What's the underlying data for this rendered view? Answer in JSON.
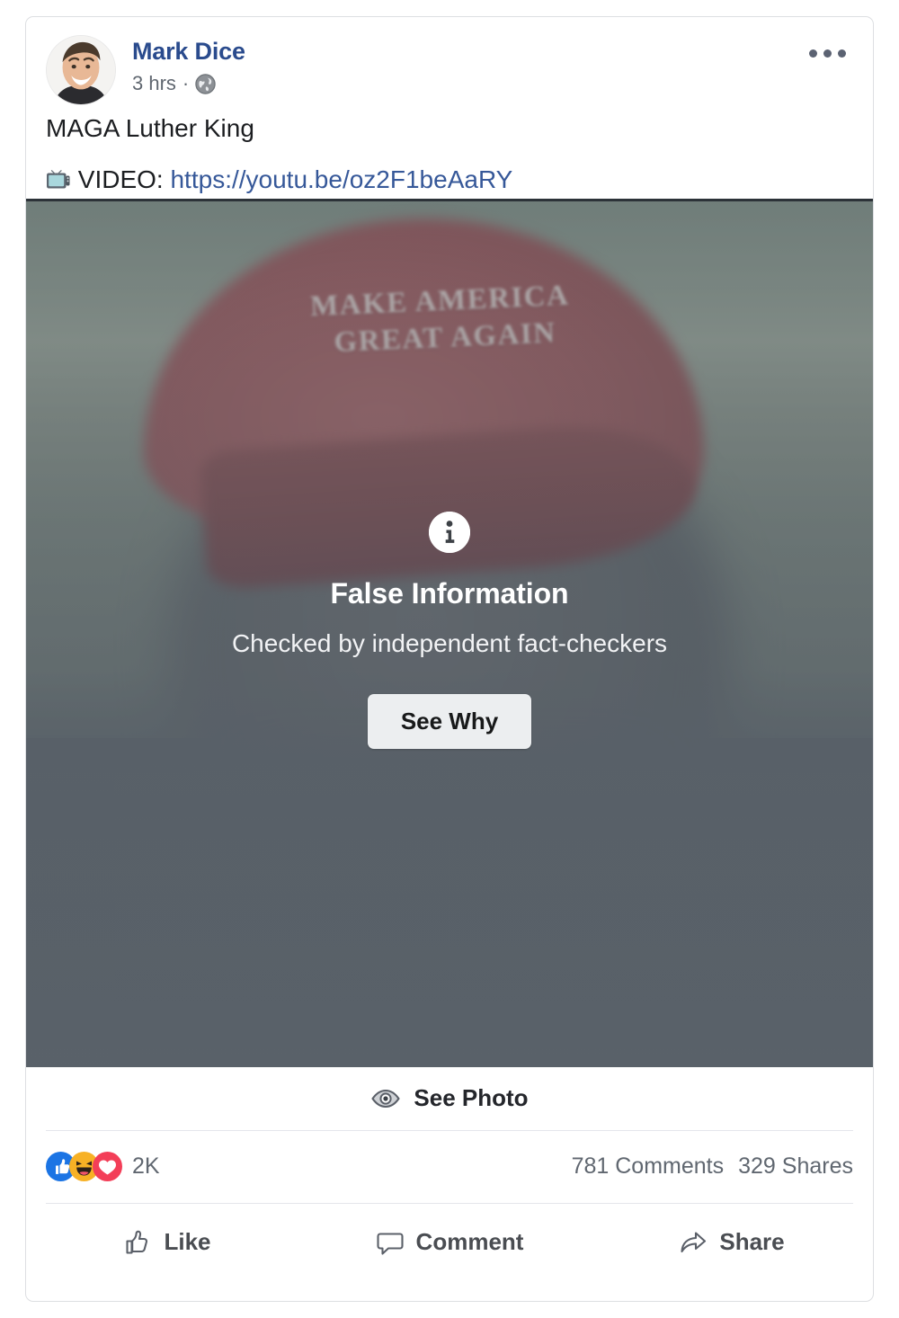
{
  "post": {
    "author": "Mark Dice",
    "timestamp": "3 hrs",
    "meta_separator": "·",
    "privacy_icon": "globe-icon",
    "more_icon": "more-options-icon",
    "avatar_icon": "avatar",
    "text_line_1": "MAGA Luther King",
    "text_line_2_prefix": "VIDEO: ",
    "text_line_2_emoji": "television-emoji",
    "link_text": "https://youtu.be/oz2F1beAaRY"
  },
  "media": {
    "cap_text_line_1": "MAKE AMERICA",
    "cap_text_line_2": "GREAT AGAIN",
    "alt": "blurred photo of a man wearing a red MAGA cap"
  },
  "fact_check": {
    "icon": "info-icon",
    "title": "False Information",
    "subtitle": "Checked by independent fact-checkers",
    "button_label": "See Why"
  },
  "see_photo": {
    "icon": "eye-icon",
    "label": "See Photo"
  },
  "engagement": {
    "reactions": [
      {
        "name": "like-reaction-icon",
        "color": "#1b74e4"
      },
      {
        "name": "haha-reaction-icon",
        "color": "#f7b125"
      },
      {
        "name": "love-reaction-icon",
        "color": "#f33e58"
      }
    ],
    "reaction_count": "2K",
    "comments": "781 Comments",
    "shares": "329 Shares"
  },
  "actions": [
    {
      "icon": "thumbs-up-icon",
      "label": "Like"
    },
    {
      "icon": "comment-bubble-icon",
      "label": "Comment"
    },
    {
      "icon": "share-arrow-icon",
      "label": "Share"
    }
  ],
  "colors": {
    "link": "#365899",
    "author": "#2a4b8d",
    "muted_text": "#606770",
    "card_border": "#dddfe2"
  }
}
